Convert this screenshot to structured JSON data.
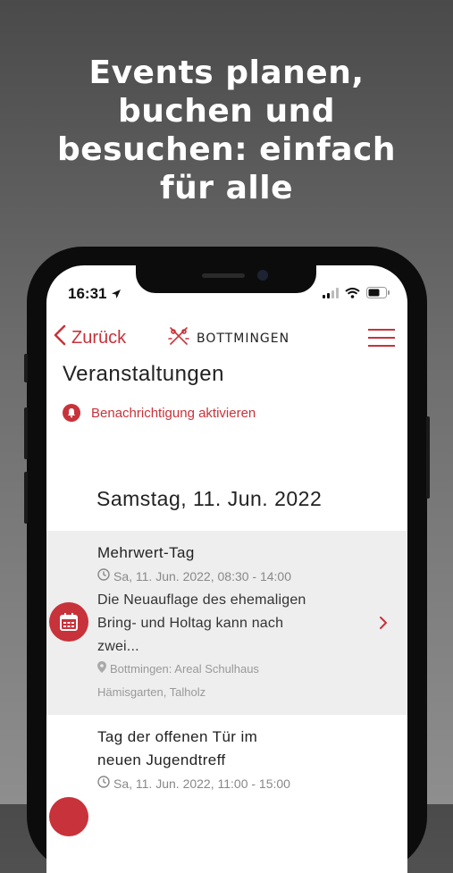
{
  "headline": {
    "line1": "Events planen,",
    "line2": "buchen und",
    "line3": "besuchen: einfach",
    "line4": "für alle"
  },
  "status_bar": {
    "time": "16:31"
  },
  "navbar": {
    "back_label": "Zurück",
    "brand_name": "BOTTMINGEN"
  },
  "page": {
    "title": "Veranstaltungen",
    "notify_label": "Benachrichtigung aktivieren",
    "date_heading": "Samstag, 11. Jun. 2022"
  },
  "events": [
    {
      "title": "Mehrwert-Tag",
      "time": "Sa, 11. Jun. 2022, 08:30 - 14:00",
      "description_lines": [
        "Die Neuauflage des ehemaligen",
        "Bring- und Holtag kann nach",
        "zwei..."
      ],
      "location_lines": [
        "Bottmingen: Areal Schulhaus",
        "Hämisgarten, Talholz"
      ]
    },
    {
      "title_lines": [
        "Tag der offenen Tür im",
        "neuen Jugendtreff"
      ],
      "time": "Sa, 11. Jun. 2022, 11:00 - 15:00"
    }
  ],
  "colors": {
    "accent": "#c8323a",
    "selected_row": "#eeeeee"
  },
  "icons": [
    "location-arrow-icon",
    "signal-icon",
    "wifi-icon",
    "battery-icon",
    "chevron-left-icon",
    "bottmingen-logo-icon",
    "hamburger-menu-icon",
    "bell-icon",
    "calendar-icon",
    "clock-icon",
    "pin-icon",
    "chevron-right-icon"
  ]
}
